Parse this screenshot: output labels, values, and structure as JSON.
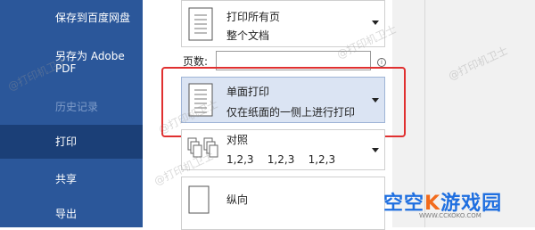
{
  "sidebar": {
    "items": [
      {
        "label": "保存到百度网盘",
        "state": "normal"
      },
      {
        "label": "另存为 Adobe",
        "label2": "PDF",
        "state": "normal"
      },
      {
        "label": "历史记录",
        "state": "disabled"
      },
      {
        "label": "打印",
        "state": "selected"
      },
      {
        "label": "共享",
        "state": "normal"
      },
      {
        "label": "导出",
        "state": "normal"
      }
    ]
  },
  "settings": {
    "print_range": {
      "title": "打印所有页",
      "subtitle": "整个文档",
      "icon": "document-icon"
    },
    "pages": {
      "label": "页数:",
      "value": "",
      "info_icon": "info-icon"
    },
    "sides": {
      "title": "单面打印",
      "subtitle": "仅在纸面的一侧上进行打印",
      "icon": "one-sided-document-icon"
    },
    "collate": {
      "title": "对照",
      "subtitle": "1,2,3    1,2,3    1,2,3",
      "icon": "collate-icon"
    },
    "orientation": {
      "title": "纵向",
      "icon": "portrait-icon"
    }
  },
  "watermarks": [
    "@打印机卫士",
    "@打印机卫士",
    "@打印机卫士",
    "@打印机卫士",
    "@打印机卫士"
  ],
  "logo": {
    "text_part1": "空空",
    "text_part2": "游戏园",
    "url": "WWW.CCKOKO.COM"
  },
  "colors": {
    "sidebar": "#2b579a",
    "selected_nav": "#1b3f77",
    "highlight_border": "#e03030",
    "selected_option": "#dbe4f3"
  }
}
